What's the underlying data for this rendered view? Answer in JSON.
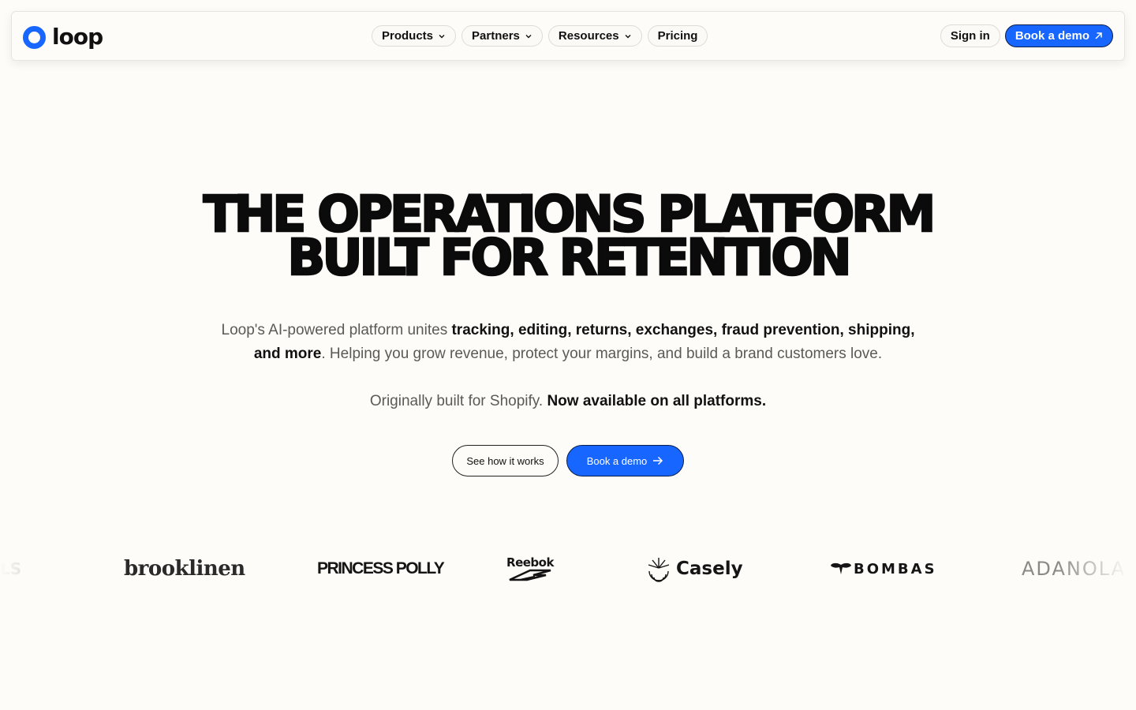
{
  "nav": {
    "logo_text": "loop",
    "items": [
      {
        "label": "Products",
        "has_dropdown": true
      },
      {
        "label": "Partners",
        "has_dropdown": true
      },
      {
        "label": "Resources",
        "has_dropdown": true
      },
      {
        "label": "Pricing",
        "has_dropdown": false
      }
    ],
    "sign_in": "Sign in",
    "book_demo": "Book a demo"
  },
  "hero": {
    "title_line1": "THE OPERATIONS PLATFORM",
    "title_line2": "BUILT FOR RETENTION",
    "sub_part1": "Loop's AI-powered platform unites ",
    "sub_bold1": "tracking, editing, returns, exchanges, fraud prevention, shipping,",
    "sub_bold2": "and more",
    "sub_part2": ". Helping you grow revenue, protect your margins, and build a brand customers love.",
    "platform_part1": "Originally built for Shopify. ",
    "platform_bold": "Now available on all platforms.",
    "cta_secondary": "See how it works",
    "cta_primary": "Book a demo"
  },
  "brands": {
    "partial_left": "LS",
    "brooklinen": "brooklinen",
    "princess_polly": "PRINCESS POLLY",
    "reebok": "Reebok",
    "casely": "Casely",
    "bombas": "BOMBAS",
    "adanola": "ADANOLA"
  },
  "colors": {
    "accent": "#1766ff",
    "background": "#fdfcf8",
    "text": "#111111",
    "muted": "#5b5a55"
  },
  "icons": [
    "chevron-down-icon",
    "arrow-up-right-icon",
    "arrow-right-icon"
  ]
}
